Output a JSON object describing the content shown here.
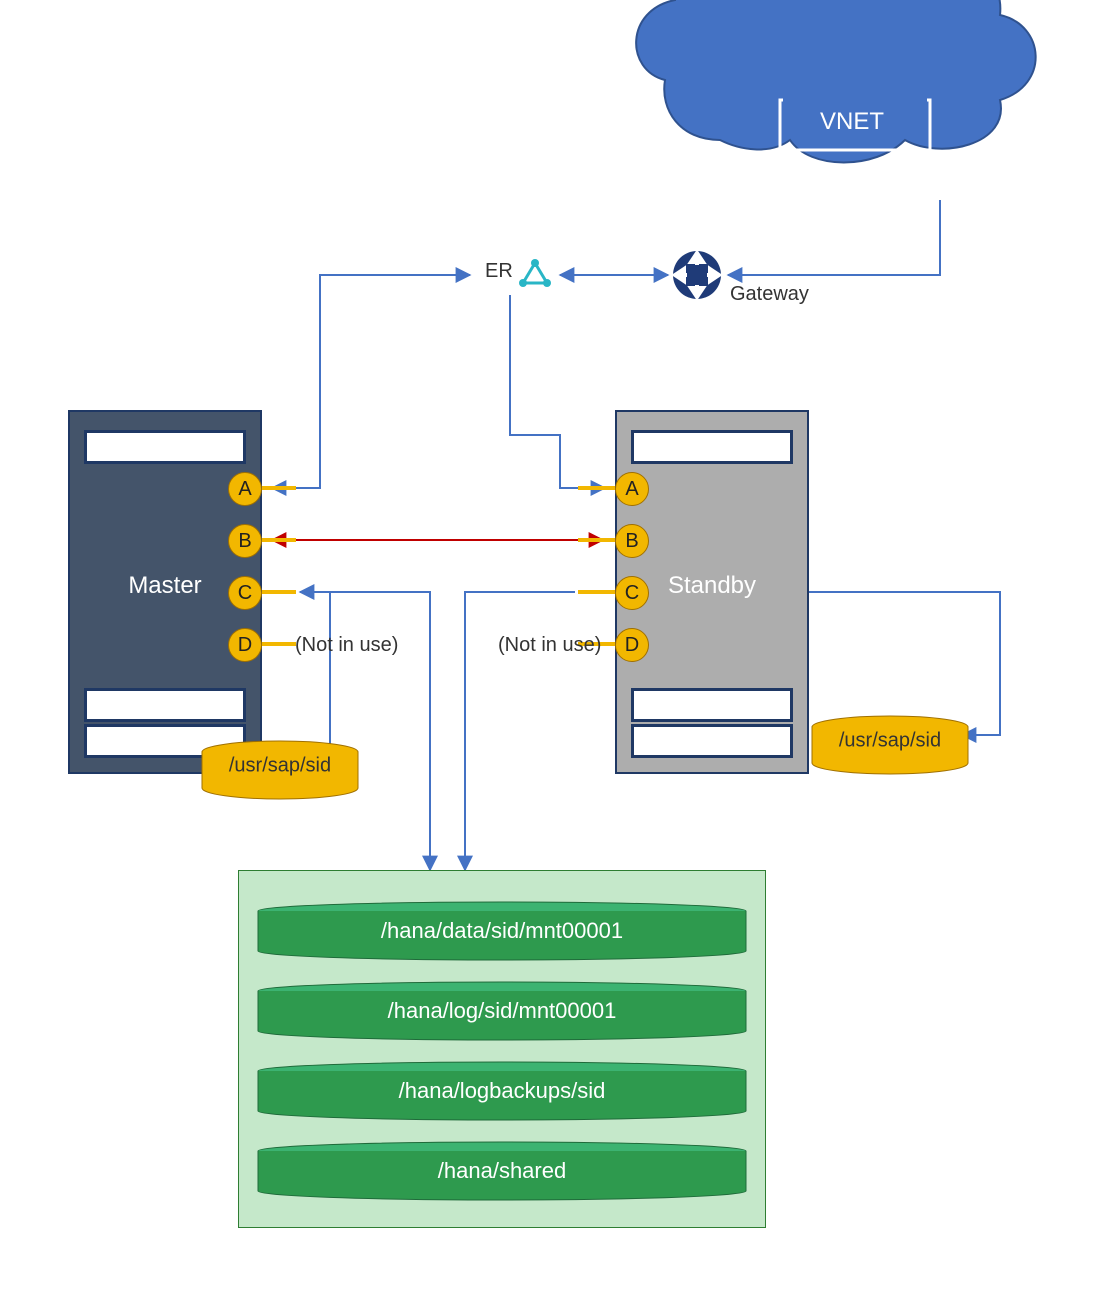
{
  "cloud": {
    "label": "VNET"
  },
  "gateway": {
    "label": "Gateway"
  },
  "er": {
    "label": "ER"
  },
  "servers": {
    "master": {
      "label": "Master",
      "ports": {
        "a": "A",
        "b": "B",
        "c": "C",
        "d": "D"
      },
      "note_d": "(Not in use)",
      "local_disk": "/usr/sap/sid"
    },
    "standby": {
      "label": "Standby",
      "ports": {
        "a": "A",
        "b": "B",
        "c": "C",
        "d": "D"
      },
      "note_d": "(Not in use)",
      "local_disk": "/usr/sap/sid"
    }
  },
  "nfs": {
    "volumes": [
      "/hana/data/sid/mnt00001",
      "/hana/log/sid/mnt00001",
      "/hana/logbackups/sid",
      "/hana/shared"
    ]
  },
  "colors": {
    "cloud": "#4472c4",
    "gateway": "#1f3b78",
    "port": "#f2b700",
    "disk": "#f2b700",
    "nfs_bg": "#c5e8ca",
    "nfs_vol": "#2ca02c",
    "arrow": "#4472c4",
    "red": "#c00000"
  }
}
